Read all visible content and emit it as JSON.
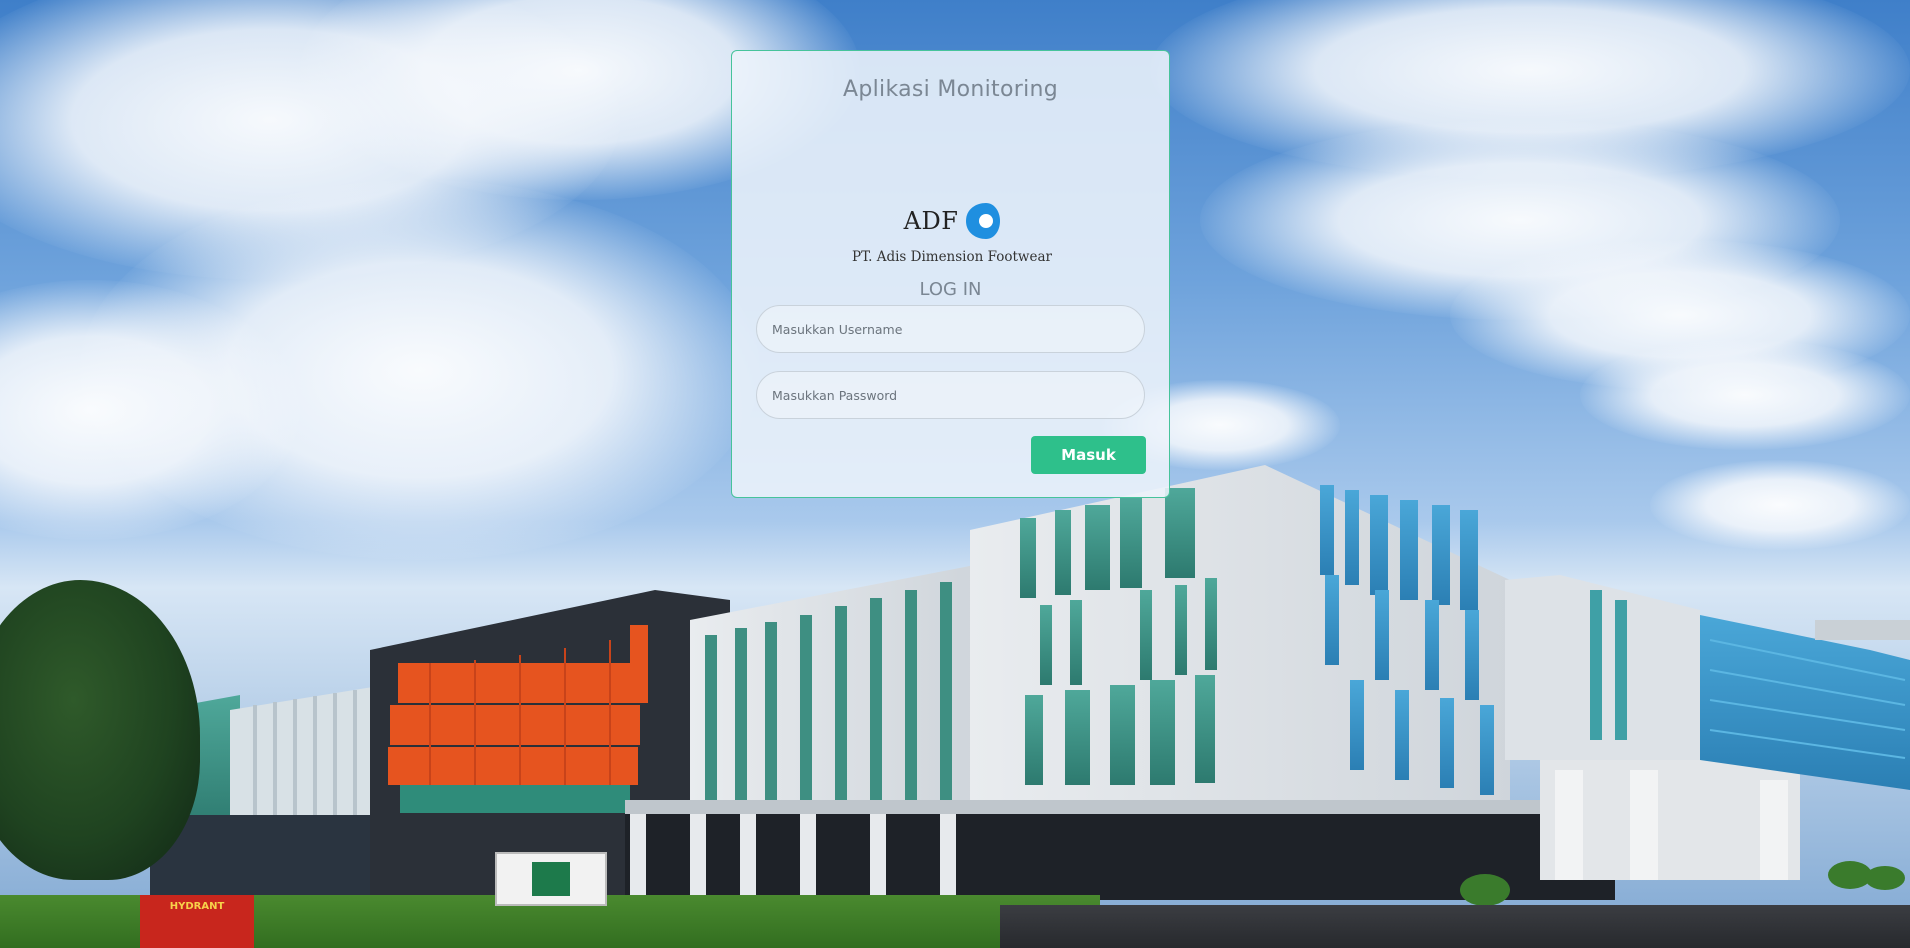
{
  "app": {
    "title": "Aplikasi Monitoring"
  },
  "logo": {
    "mark_text": "ADF",
    "company_name": "PT. Adis Dimension Footwear"
  },
  "login": {
    "heading": "LOG IN",
    "username_placeholder": "Masukkan Username",
    "password_placeholder": "Masukkan Password",
    "submit_label": "Masuk"
  },
  "background": {
    "hydrant_text": "HYDRANT"
  },
  "colors": {
    "accent": "#2ec08b",
    "card_border": "#46c39b",
    "logo_blue": "#1f8fe0",
    "facade_orange": "#e6541f"
  }
}
